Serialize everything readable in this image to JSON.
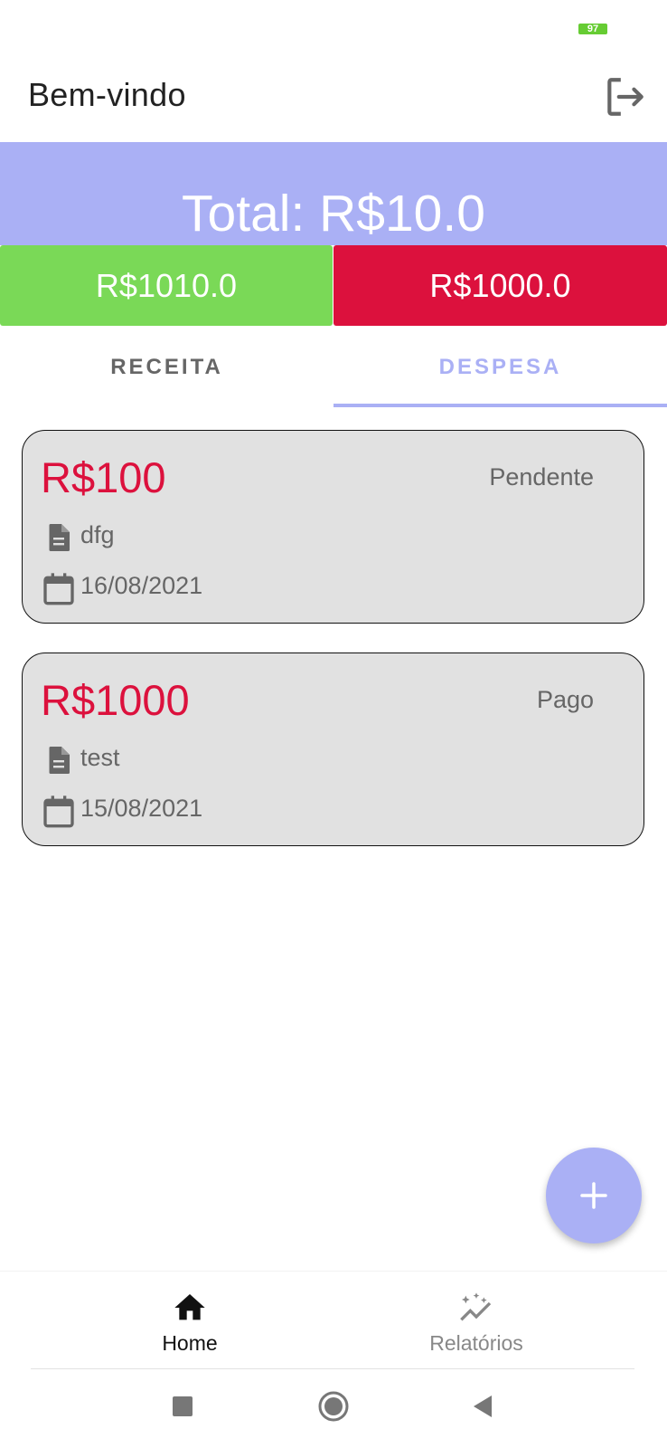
{
  "status_bar": {
    "battery": "97",
    "battery_color": "#66cc33"
  },
  "app_bar": {
    "title": "Bem-vindo",
    "logout_icon": "logout-icon"
  },
  "summary": {
    "total": "Total: R$10.0",
    "income": "R$1010.0",
    "expense": "R$1000.0",
    "colors": {
      "banner": "#aab0f5",
      "income": "#7ad957",
      "expense": "#dc113d"
    }
  },
  "tabs": [
    {
      "label": "RECEITA",
      "selected": false
    },
    {
      "label": "DESPESA",
      "selected": true
    }
  ],
  "transactions": [
    {
      "amount": "R$100",
      "status": "Pendente",
      "description": "dfg",
      "date": "16/08/2021"
    },
    {
      "amount": "R$1000",
      "status": "Pago",
      "description": "test",
      "date": "15/08/2021"
    }
  ],
  "fab": {
    "icon": "plus-icon"
  },
  "bottom_nav": {
    "items": [
      {
        "label": "Home",
        "icon": "home-icon",
        "active": true
      },
      {
        "label": "Relatórios",
        "icon": "reports-icon",
        "active": false
      }
    ]
  },
  "system_nav": {
    "icons": [
      "recents-icon",
      "home-circle-icon",
      "back-icon"
    ]
  }
}
